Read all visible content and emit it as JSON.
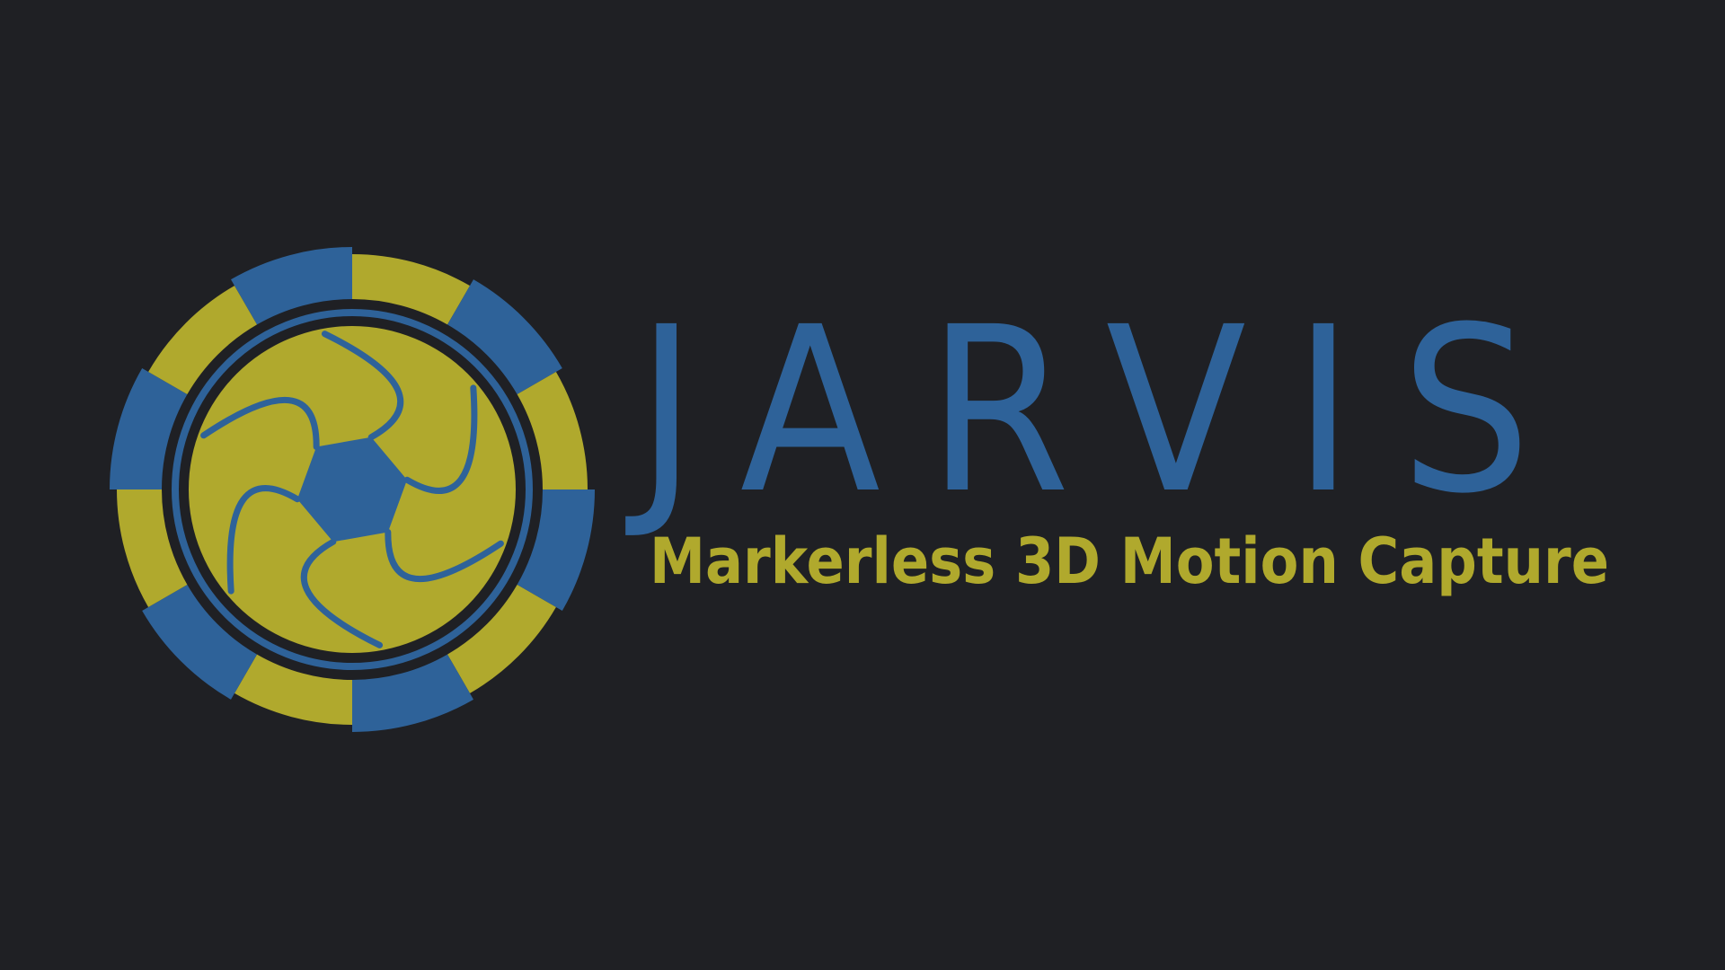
{
  "colors": {
    "background": "#1f2024",
    "brand_blue": "#2e6299",
    "brand_yellow": "#b0a92d"
  },
  "logo": {
    "icon": "camera-aperture-icon",
    "outer_segments": 12,
    "aperture_blades": 6
  },
  "brand": {
    "title": "JARVIS",
    "tagline": "Markerless 3D Motion Capture"
  }
}
